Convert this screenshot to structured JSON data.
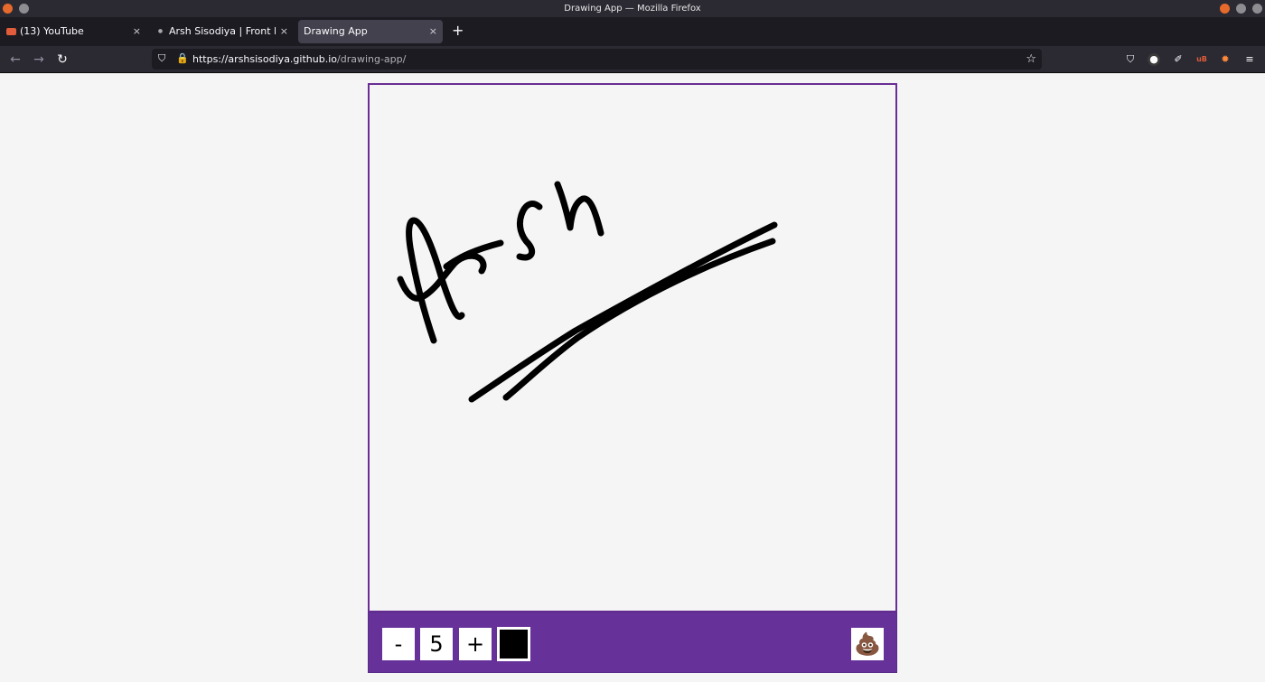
{
  "window": {
    "title": "Drawing App — Mozilla Firefox"
  },
  "tabs": [
    {
      "label": "(13) YouTube",
      "icon": "youtube-icon"
    },
    {
      "label": "Arsh Sisodiya | Front End",
      "icon": "site-icon"
    },
    {
      "label": "Drawing App",
      "active": true
    }
  ],
  "newtab_label": "+",
  "tab_close_glyph": "×",
  "address": {
    "host": "https://arshsisodiya.github.io",
    "path": "/drawing-app/"
  },
  "nav": {
    "back": "←",
    "forward": "→",
    "reload": "↻",
    "star": "☆",
    "shield": "⛉",
    "lock": "🔒",
    "menu": "≡"
  },
  "extensions": {
    "pocket": "⛉",
    "e2": "●",
    "e3": "✐",
    "e4": "uB",
    "e5": "✹"
  },
  "canvas": {
    "border_color": "#6a2e94",
    "stroke_color": "#000000"
  },
  "toolbox": {
    "background": "#66329a",
    "decrease_label": "-",
    "size_value": "5",
    "increase_label": "+",
    "selected_color": "#000000",
    "clear_label": "💩"
  }
}
